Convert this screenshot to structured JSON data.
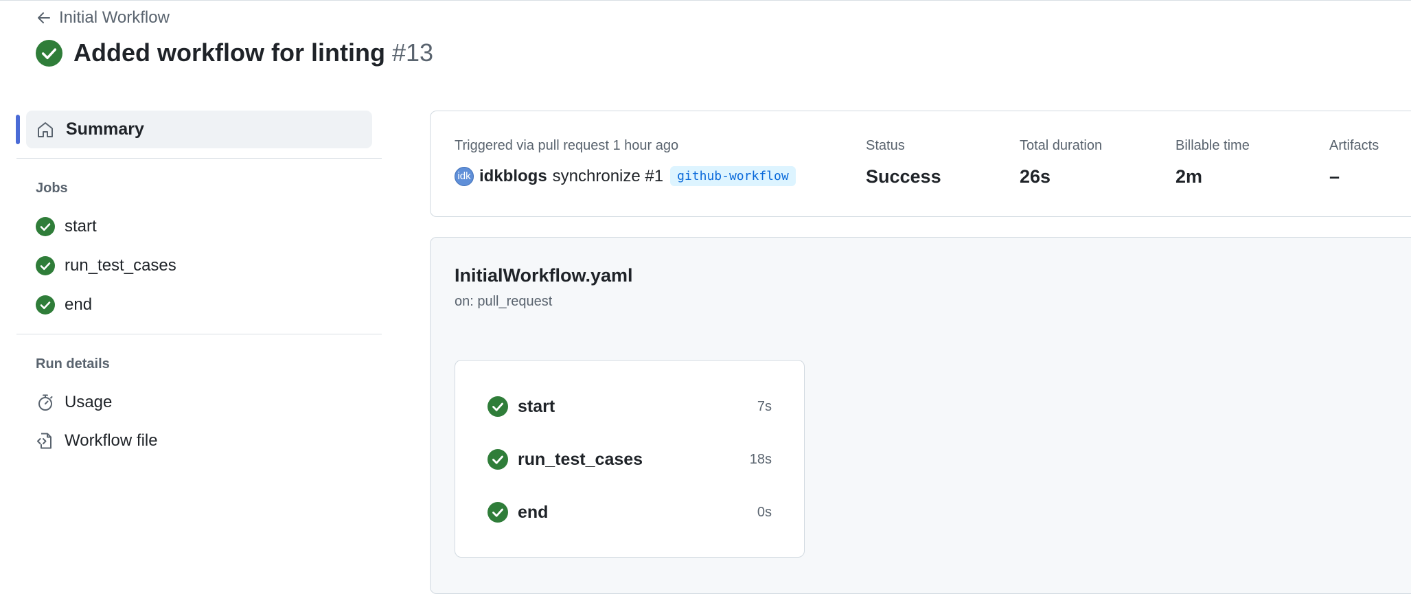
{
  "colors": {
    "success": "#2f7d39",
    "accent": "#4a6bd6",
    "muted_text": "#59636e",
    "branch_bg": "#ddf4ff",
    "branch_text": "#0969da"
  },
  "breadcrumb": {
    "back_label": "Initial Workflow",
    "icon": "arrow-left-icon"
  },
  "header": {
    "title": "Added workflow for linting",
    "run_number": "#13",
    "status_icon": "check-circle-icon"
  },
  "sidebar": {
    "summary_label": "Summary",
    "jobs_title": "Jobs",
    "jobs": [
      {
        "label": "start"
      },
      {
        "label": "run_test_cases"
      },
      {
        "label": "end"
      }
    ],
    "run_details_title": "Run details",
    "run_details": [
      {
        "label": "Usage",
        "icon": "stopwatch-icon"
      },
      {
        "label": "Workflow file",
        "icon": "file-code-icon"
      }
    ]
  },
  "run_info": {
    "trigger_text": "Triggered via pull request 1 hour ago",
    "avatar_text": "idk",
    "actor": "idkblogs",
    "event": "synchronize #1",
    "branch": "github-workflow",
    "stats": [
      {
        "label": "Status",
        "value": "Success"
      },
      {
        "label": "Total duration",
        "value": "26s"
      },
      {
        "label": "Billable time",
        "value": "2m"
      },
      {
        "label": "Artifacts",
        "value": "–"
      }
    ]
  },
  "workflow": {
    "file_name": "InitialWorkflow.yaml",
    "trigger": "on: pull_request",
    "jobs": [
      {
        "name": "start",
        "duration": "7s"
      },
      {
        "name": "run_test_cases",
        "duration": "18s"
      },
      {
        "name": "end",
        "duration": "0s"
      }
    ]
  }
}
